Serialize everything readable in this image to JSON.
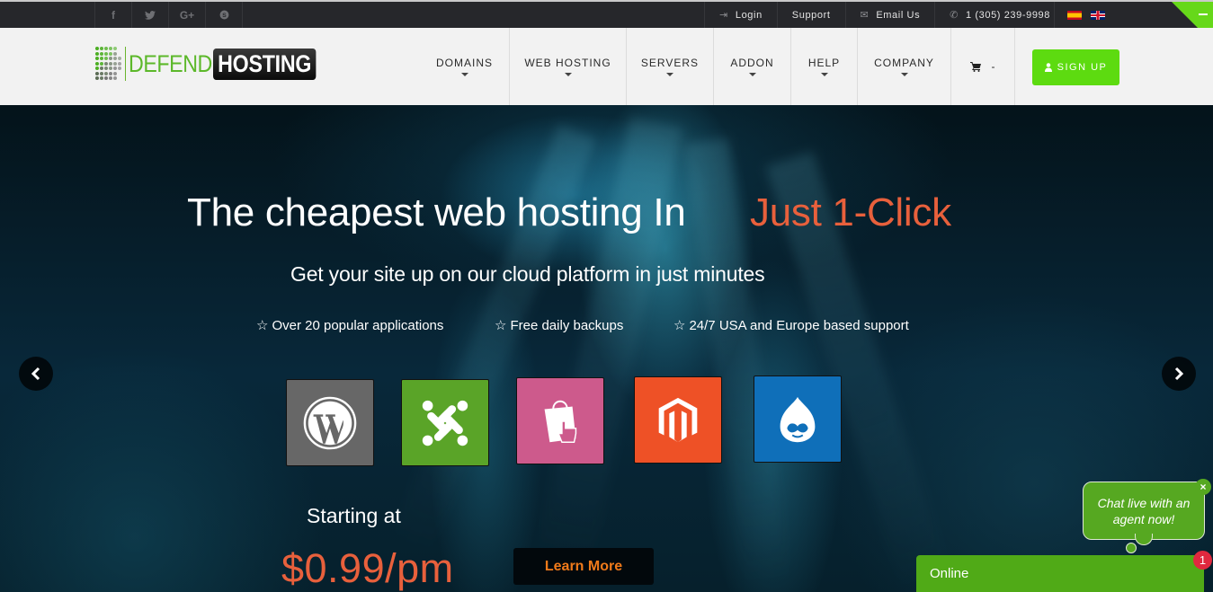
{
  "topbar": {
    "social": [
      {
        "name": "facebook-icon",
        "glyph": "f"
      },
      {
        "name": "twitter-icon",
        "glyph": "🐦"
      },
      {
        "name": "google-plus-icon",
        "glyph": "G+"
      },
      {
        "name": "skype-icon",
        "glyph": "S"
      }
    ],
    "login_label": "Login",
    "support_label": "Support",
    "email_label": "Email Us",
    "phone": "1 (305) 239-9998",
    "languages": [
      "es",
      "en-gb"
    ],
    "corner_icon": "minus-icon"
  },
  "header": {
    "logo_part1": "DEFEND",
    "logo_part2": "HOSTING",
    "nav": [
      {
        "label": "DOMAINS",
        "dropdown": true
      },
      {
        "label": "WEB HOSTING",
        "dropdown": true
      },
      {
        "label": "SERVERS",
        "dropdown": true
      },
      {
        "label": "ADDON",
        "dropdown": false
      },
      {
        "label": "HELP",
        "dropdown": true
      },
      {
        "label": "COMPANY",
        "dropdown": true
      }
    ],
    "cart_label": "-",
    "signup_label": "SIGN UP"
  },
  "hero": {
    "headline_white": "The cheapest web hosting In",
    "headline_accent": "Just 1-Click",
    "subheadline": "Get your site up on our cloud platform in just minutes",
    "features": [
      "Over 20 popular applications",
      "Free daily backups",
      "24/7 USA and Europe based support"
    ],
    "apps": [
      {
        "name": "wordpress",
        "color": "#676767"
      },
      {
        "name": "joomla",
        "color": "#5aa428"
      },
      {
        "name": "prestashop",
        "color": "#cd5a8c"
      },
      {
        "name": "magento",
        "color": "#ee5126"
      },
      {
        "name": "drupal",
        "color": "#0f6fb9"
      }
    ],
    "starting_label": "Starting at",
    "price": "$0.99/pm",
    "learn_more_label": "Learn More",
    "prev_glyph": "‹",
    "next_glyph": "›"
  },
  "chat": {
    "bubble_text": "Chat live with an agent now!",
    "close_glyph": "×",
    "status": "Online",
    "unread_count": "1"
  },
  "colors": {
    "accent_green": "#5ddb10",
    "accent_orange": "#e8603c",
    "topbar_bg": "#26272b",
    "header_bg": "#f2f2f2",
    "chat_green": "#50aa17",
    "badge_red": "#e0283f"
  }
}
